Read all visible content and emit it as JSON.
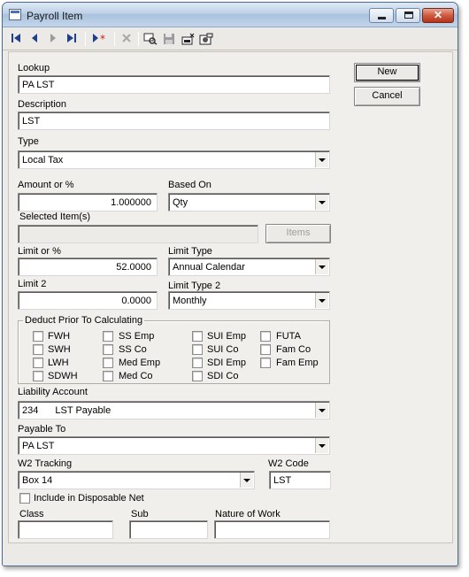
{
  "window": {
    "title": "Payroll Item"
  },
  "toolbar": {
    "first": "first-record",
    "prev": "previous-record",
    "next": "next-record",
    "last": "last-record",
    "new": "new-record",
    "delete": "delete-record",
    "find": "find-record",
    "save": "save-record",
    "print": "print-record",
    "setup": "setup-record"
  },
  "form": {
    "lookup": {
      "label": "Lookup",
      "value": "PA LST"
    },
    "description": {
      "label": "Description",
      "value": "LST"
    },
    "type": {
      "label": "Type",
      "value": "Local Tax"
    },
    "amount": {
      "label": "Amount or %",
      "value": "1.000000"
    },
    "based_on": {
      "label": "Based On",
      "value": "Qty"
    },
    "selected_items": {
      "label": "Selected Item(s)",
      "value": "",
      "button": "Items"
    },
    "limit": {
      "label": "Limit or %",
      "value": "52.0000"
    },
    "limit_type": {
      "label": "Limit Type",
      "value": "Annual Calendar"
    },
    "limit2": {
      "label": "Limit 2",
      "value": "0.0000"
    },
    "limit_type2": {
      "label": "Limit Type 2",
      "value": "Monthly"
    },
    "deduct": {
      "legend": "Deduct Prior To Calculating",
      "col1": [
        "FWH",
        "SWH",
        "LWH",
        "SDWH"
      ],
      "col2": [
        "SS Emp",
        "SS Co",
        "Med Emp",
        "Med Co"
      ],
      "col3": [
        "SUI Emp",
        "SUI Co",
        "SDI Emp",
        "SDI Co"
      ],
      "col4": [
        "FUTA",
        "Fam Co",
        "Fam Emp"
      ]
    },
    "liability": {
      "label": "Liability Account",
      "code": "234",
      "name": "LST Payable"
    },
    "payable_to": {
      "label": "Payable To",
      "value": "PA LST"
    },
    "w2_tracking": {
      "label": "W2 Tracking",
      "value": "Box 14"
    },
    "w2_code": {
      "label": "W2 Code",
      "value": "LST"
    },
    "disposable": {
      "label": "Include in Disposable Net",
      "checked": false
    },
    "class": {
      "label": "Class",
      "value": ""
    },
    "sub": {
      "label": "Sub",
      "value": ""
    },
    "nature": {
      "label": "Nature of Work",
      "value": ""
    }
  },
  "buttons": {
    "new": "New",
    "cancel": "Cancel"
  }
}
